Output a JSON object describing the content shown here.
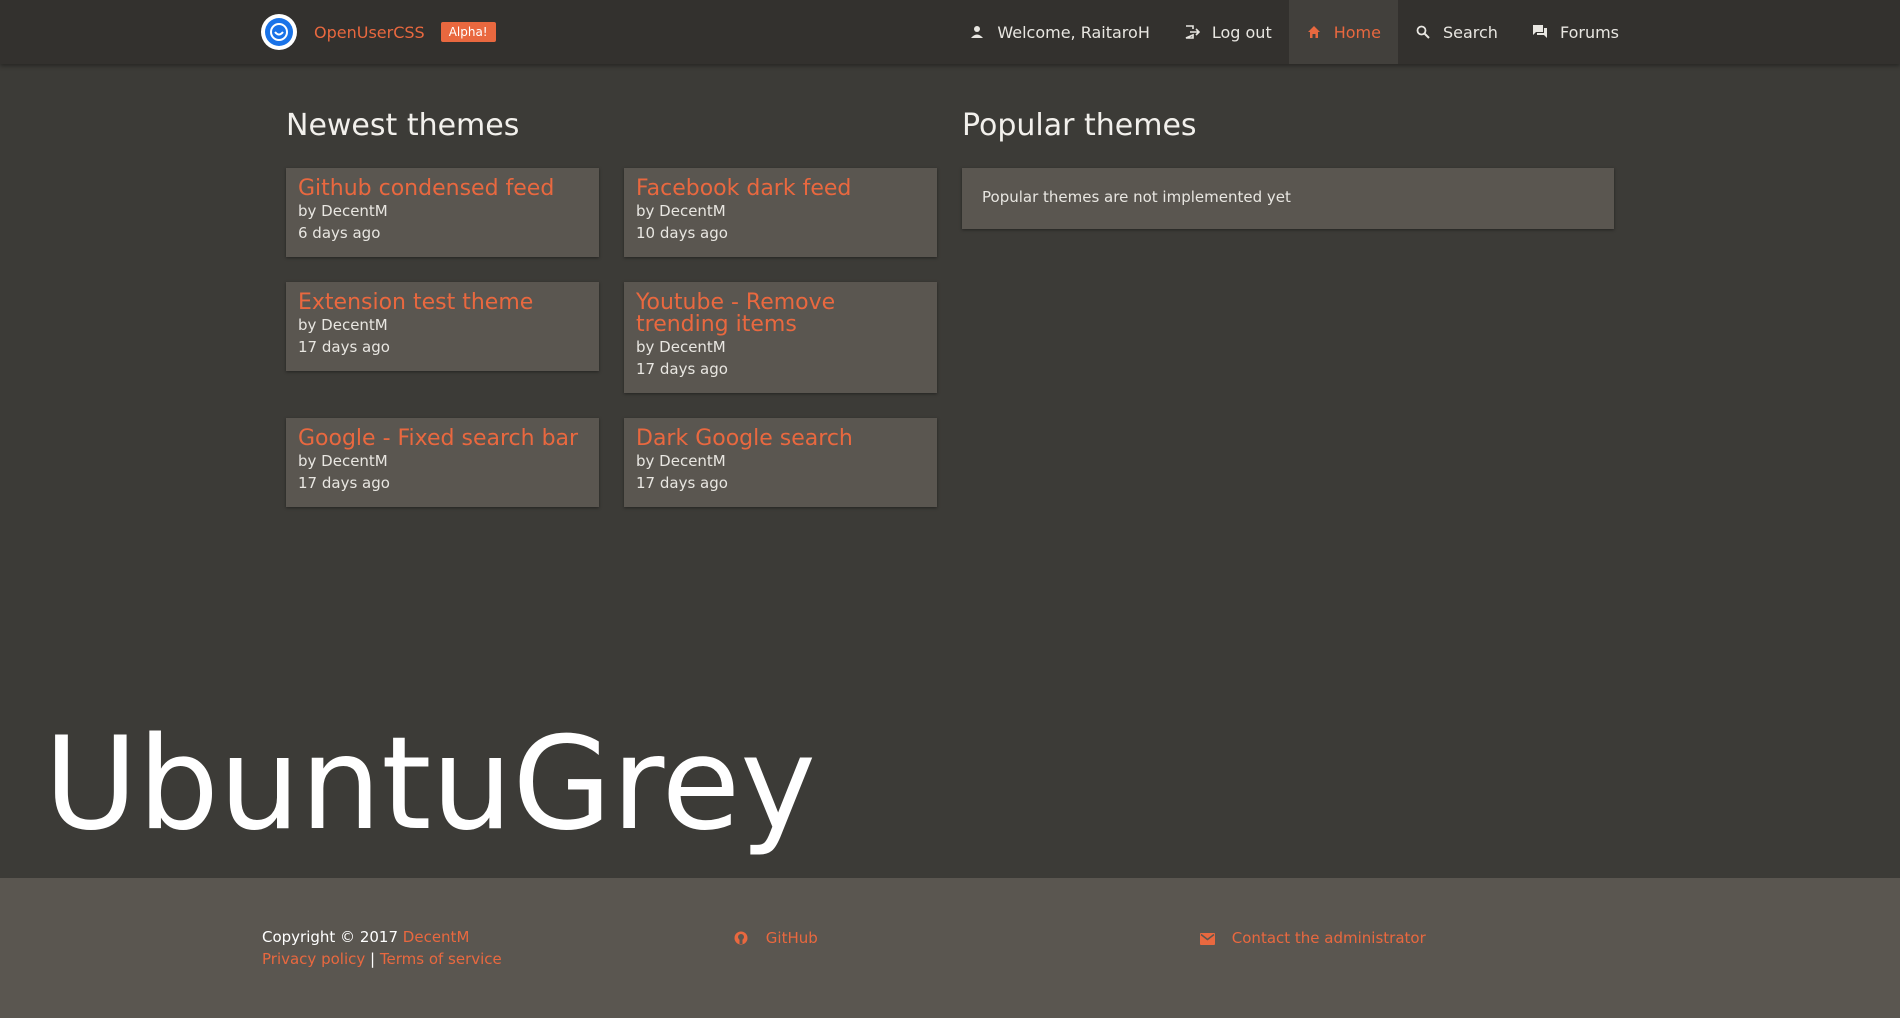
{
  "navbar": {
    "brand_name": "OpenUserCSS",
    "badge": "Alpha!",
    "items": [
      {
        "label": "Welcome, RaitaroH",
        "icon": "user-icon"
      },
      {
        "label": "Log out",
        "icon": "logout-icon"
      },
      {
        "label": "Home",
        "icon": "home-icon",
        "active": true
      },
      {
        "label": "Search",
        "icon": "search-icon"
      },
      {
        "label": "Forums",
        "icon": "forum-icon"
      }
    ]
  },
  "newest": {
    "title": "Newest themes",
    "themes": [
      {
        "title": "Github condensed feed",
        "author": "by DecentM",
        "age": "6 days ago"
      },
      {
        "title": "Facebook dark feed",
        "author": "by DecentM",
        "age": "10 days ago"
      },
      {
        "title": "Extension test theme",
        "author": "by DecentM",
        "age": "17 days ago"
      },
      {
        "title": "Youtube - Remove trending items",
        "author": "by DecentM",
        "age": "17 days ago"
      },
      {
        "title": "Google - Fixed search bar",
        "author": "by DecentM",
        "age": "17 days ago"
      },
      {
        "title": "Dark Google search",
        "author": "by DecentM",
        "age": "17 days ago"
      }
    ]
  },
  "popular": {
    "title": "Popular themes",
    "message": "Popular themes are not implemented yet"
  },
  "watermark": "UbuntuGrey",
  "footer": {
    "copyright": "Copyright © 2017",
    "author_link": "DecentM",
    "privacy": "Privacy policy",
    "separator": "|",
    "terms": "Terms of service",
    "github": "GitHub",
    "contact": "Contact the administrator"
  },
  "colors": {
    "accent": "#e9683f",
    "background": "#3c3b37",
    "navbar": "#33312e",
    "card": "#5a5650"
  }
}
